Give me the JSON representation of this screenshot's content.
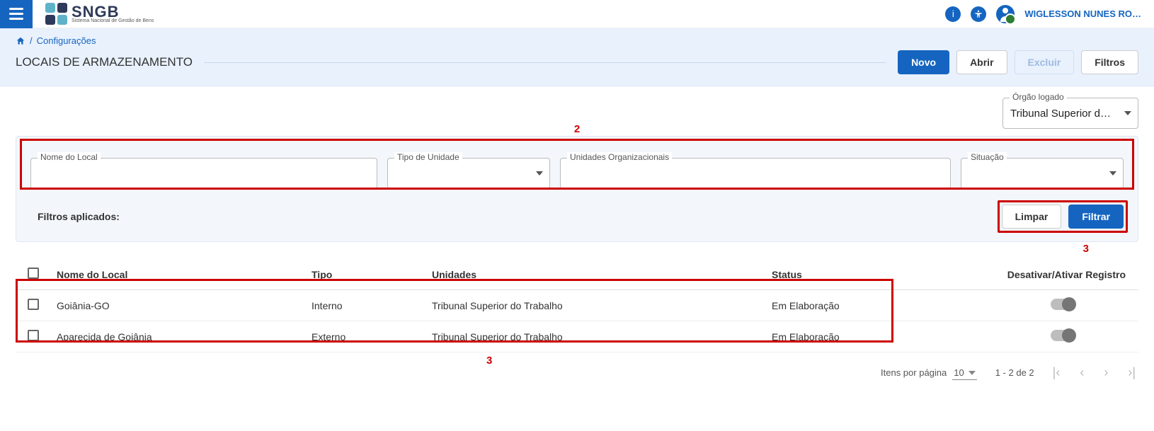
{
  "topbar": {
    "logo_main": "SNGB",
    "logo_sub": "Sistema Nacional de Gestão de Bens",
    "username": "WIGLESSON NUNES RO…"
  },
  "breadcrumb": {
    "item": "Configurações"
  },
  "page": {
    "title": "LOCAIS DE ARMAZENAMENTO"
  },
  "actions": {
    "novo": "Novo",
    "abrir": "Abrir",
    "excluir": "Excluir",
    "filtros": "Filtros"
  },
  "orgao": {
    "label": "Órgão logado",
    "value": "Tribunal Superior do Tra…"
  },
  "filters": {
    "nome_label": "Nome do Local",
    "tipo_label": "Tipo de Unidade",
    "unidades_label": "Unidades Organizacionais",
    "situacao_label": "Situação",
    "applied_label": "Filtros aplicados:",
    "limpar": "Limpar",
    "filtrar": "Filtrar"
  },
  "annotations": {
    "top": "2",
    "right": "3",
    "bottom": "3"
  },
  "table": {
    "headers": {
      "nome": "Nome do Local",
      "tipo": "Tipo",
      "unidades": "Unidades",
      "status": "Status",
      "toggle": "Desativar/Ativar Registro"
    },
    "rows": [
      {
        "nome": "Goiânia-GO",
        "tipo": "Interno",
        "unidades": "Tribunal Superior do Trabalho",
        "status": "Em Elaboração"
      },
      {
        "nome": "Aparecida de Goiânia",
        "tipo": "Externo",
        "unidades": "Tribunal Superior do Trabalho",
        "status": "Em Elaboração"
      }
    ]
  },
  "paginator": {
    "items_label": "Itens por página",
    "page_size": "10",
    "range": "1 - 2 de 2"
  }
}
